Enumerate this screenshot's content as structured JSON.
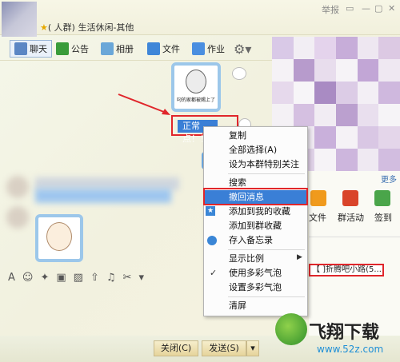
{
  "window": {
    "title": "(   人群) 生活休闲-其他",
    "report_btn": "举报"
  },
  "toolbar": {
    "items": [
      "聊天",
      "公告",
      "相册",
      "文件",
      "作业"
    ]
  },
  "chat": {
    "sticker_caption": "叼的家都被赐上了",
    "selected_message": "正常点！！"
  },
  "context_menu": {
    "items": [
      "复制",
      "全部选择(A)",
      "设为本群特别关注",
      "搜索",
      "撤回消息",
      "添加到我的收藏",
      "添加到群收藏",
      "存入备忘录",
      "显示比例",
      "使用多彩气泡",
      "设置多彩气泡",
      "清屏"
    ],
    "highlighted": "撤回消息"
  },
  "right_panel": {
    "more": "更多",
    "apps": [
      "文件",
      "群活动",
      "签到"
    ],
    "announcement": "【  ]折腾吧小路(5..."
  },
  "bottom": {
    "close": "关闭(C)",
    "send": "发送(S)"
  },
  "watermark": {
    "brand": "飞翔下载",
    "url": "www.52z.com"
  }
}
